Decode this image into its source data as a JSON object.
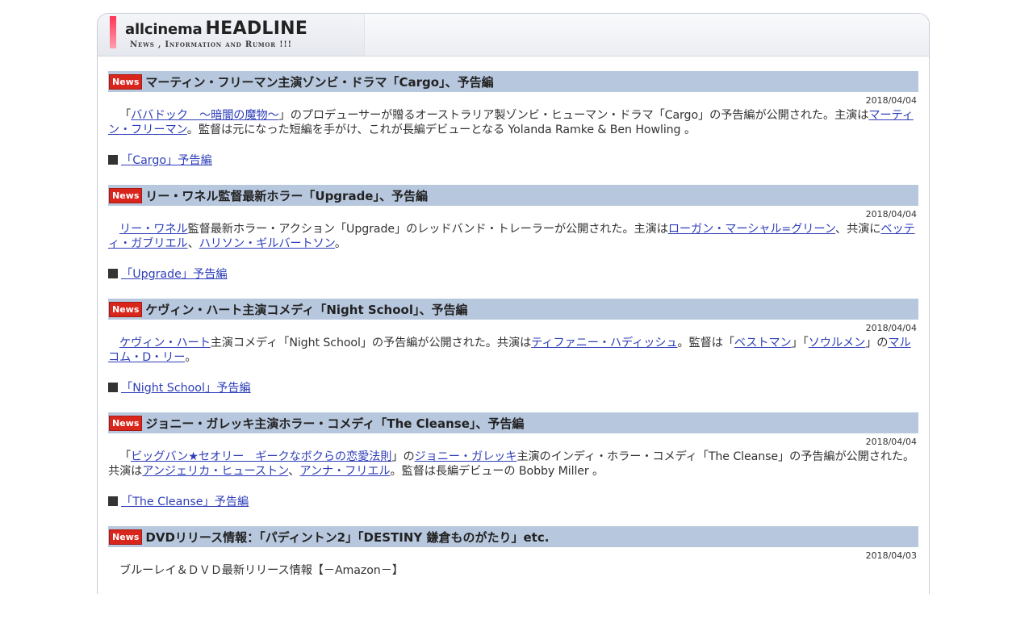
{
  "header": {
    "brand_small": "allcinema",
    "brand_big": "HEADLINE",
    "tagline": "News , Information and Rumor !!!"
  },
  "articles": [
    {
      "badge": "News",
      "title": "マーティン・フリーマン主演ゾンビ・ドラマ「Cargo」、予告編",
      "date": "2018/04/04",
      "body": [
        {
          "t": "「"
        },
        {
          "t": "ババドック　～暗闇の魔物～",
          "link": true
        },
        {
          "t": "」のプロデューサーが贈るオーストラリア製ゾンビ・ヒューマン・ドラマ「Cargo」の予告編が公開された。主演は"
        },
        {
          "t": "マーティン・フリーマン",
          "link": true
        },
        {
          "t": "。監督は元になった短編を手がけ、これが長編デビューとなる Yolanda Ramke & Ben Howling 。"
        }
      ],
      "trailer": "「Cargo」予告編"
    },
    {
      "badge": "News",
      "title": "リー・ワネル監督最新ホラー「Upgrade」、予告編",
      "date": "2018/04/04",
      "body": [
        {
          "t": "リー・ワネル",
          "link": true
        },
        {
          "t": "監督最新ホラー・アクション「Upgrade」のレッドバンド・トレーラーが公開された。主演は"
        },
        {
          "t": "ローガン・マーシャル=グリーン",
          "link": true
        },
        {
          "t": "、共演に"
        },
        {
          "t": "ベッティ・ガブリエル",
          "link": true
        },
        {
          "t": "、"
        },
        {
          "t": "ハリソン・ギルバートソン",
          "link": true
        },
        {
          "t": "。"
        }
      ],
      "trailer": "「Upgrade」予告編"
    },
    {
      "badge": "News",
      "title": "ケヴィン・ハート主演コメディ「Night School」、予告編",
      "date": "2018/04/04",
      "body": [
        {
          "t": "ケヴィン・ハート",
          "link": true
        },
        {
          "t": "主演コメディ「Night School」の予告編が公開された。共演は"
        },
        {
          "t": "ティファニー・ハディッシュ",
          "link": true
        },
        {
          "t": "。監督は「"
        },
        {
          "t": "ベストマン",
          "link": true
        },
        {
          "t": "」「"
        },
        {
          "t": "ソウルメン",
          "link": true
        },
        {
          "t": "」の"
        },
        {
          "t": "マルコム・D・リー",
          "link": true
        },
        {
          "t": "。"
        }
      ],
      "trailer": "「Night School」予告編"
    },
    {
      "badge": "News",
      "title": "ジョニー・ガレッキ主演ホラー・コメディ「The Cleanse」、予告編",
      "date": "2018/04/04",
      "body": [
        {
          "t": "「"
        },
        {
          "t": "ビッグバン★セオリー　ギークなボクらの恋愛法則",
          "link": true
        },
        {
          "t": "」の"
        },
        {
          "t": "ジョニー・ガレッキ",
          "link": true
        },
        {
          "t": "主演のインディ・ホラー・コメディ「The Cleanse」の予告編が公開された。共演は"
        },
        {
          "t": "アンジェリカ・ヒューストン",
          "link": true
        },
        {
          "t": "、"
        },
        {
          "t": "アンナ・フリエル",
          "link": true
        },
        {
          "t": "。監督は長編デビューの Bobby Miller 。"
        }
      ],
      "trailer": "「The Cleanse」予告編"
    },
    {
      "badge": "News",
      "title": "DVDリリース情報：「パディントン2」「DESTINY 鎌倉ものがたり」etc.",
      "date": "2018/04/03",
      "body": [
        {
          "t": "ブルーレイ＆ＤＶＤ最新リリース情報【－Amazon－】"
        }
      ],
      "trailer": ""
    }
  ],
  "colors": {
    "headline_bar": "#b7c7dd",
    "news_badge": "#d9261c",
    "link": "#2e3eb8",
    "accent_stripe": "#ff3355"
  }
}
